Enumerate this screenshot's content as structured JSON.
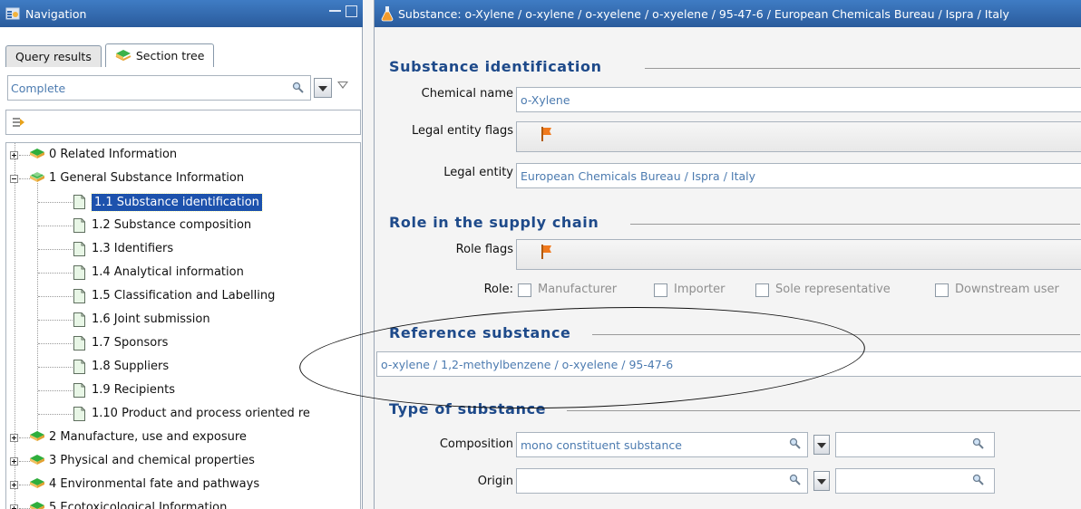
{
  "navigation": {
    "title": "Navigation",
    "tabs": [
      {
        "label": "Query results",
        "active": false
      },
      {
        "label": "Section tree",
        "active": true
      }
    ],
    "filter": {
      "value": "Complete"
    },
    "tree": [
      {
        "label": "0 Related Information"
      },
      {
        "label": "1 General Substance Information"
      },
      {
        "label": "1.1 Substance identification",
        "selected": true
      },
      {
        "label": "1.2 Substance composition"
      },
      {
        "label": "1.3 Identifiers"
      },
      {
        "label": "1.4 Analytical information"
      },
      {
        "label": "1.5 Classification and Labelling"
      },
      {
        "label": "1.6 Joint submission"
      },
      {
        "label": "1.7 Sponsors"
      },
      {
        "label": "1.8 Suppliers"
      },
      {
        "label": "1.9 Recipients"
      },
      {
        "label": "1.10 Product and process oriented re"
      },
      {
        "label": "2 Manufacture, use and exposure"
      },
      {
        "label": "3 Physical and chemical properties"
      },
      {
        "label": "4 Environmental fate and pathways"
      },
      {
        "label": "5 Ecotoxicological Information"
      }
    ]
  },
  "editor": {
    "title": "Substance: o-Xylene / o-xylene / o-xyelene / o-xyelene / 95-47-6 / European Chemicals Bureau / Ispra / Italy",
    "identification": {
      "heading": "Substance identification",
      "chemical_name_label": "Chemical name",
      "chemical_name_value": "o-Xylene",
      "legal_entity_flags_label": "Legal entity flags",
      "legal_entity_label": "Legal entity",
      "legal_entity_value": "European Chemicals Bureau / Ispra / Italy"
    },
    "supply_chain": {
      "heading": "Role in the supply chain",
      "role_flags_label": "Role flags",
      "role_label": "Role:",
      "roles": [
        "Manufacturer",
        "Importer",
        "Sole representative",
        "Downstream user"
      ]
    },
    "reference": {
      "heading": "Reference substance",
      "value": "o-xylene / 1,2-methylbenzene / o-xyelene / 95-47-6"
    },
    "type": {
      "heading": "Type of substance",
      "composition_label": "Composition",
      "composition_value": "mono constituent substance",
      "origin_label": "Origin",
      "origin_value": ""
    }
  },
  "colors": {
    "titlebar": "#2f66ad",
    "heading": "#1e4a8a",
    "selection": "#1d52ad",
    "field_text": "#4c7bb0",
    "flag": "#f07a1e"
  }
}
